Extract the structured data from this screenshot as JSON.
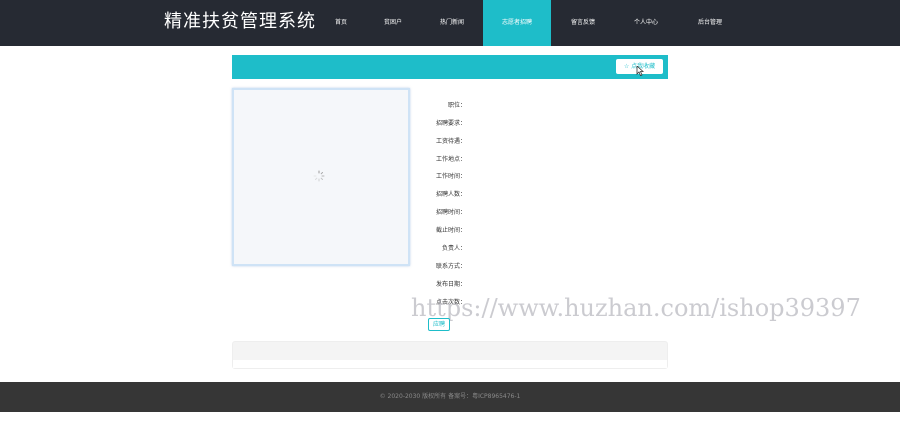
{
  "header": {
    "title": "精准扶贫管理系统",
    "nav": [
      {
        "label": "首页"
      },
      {
        "label": "贫困户"
      },
      {
        "label": "热门新闻"
      },
      {
        "label": "志愿者招聘"
      },
      {
        "label": "留言反馈"
      },
      {
        "label": "个人中心"
      },
      {
        "label": "后台管理"
      }
    ],
    "active_index": 3
  },
  "banner": {
    "favorite_label": "☆ 点我收藏"
  },
  "detail": {
    "fields": [
      {
        "label": "职位：",
        "value": ""
      },
      {
        "label": "招聘要求：",
        "value": ""
      },
      {
        "label": "工资待遇：",
        "value": ""
      },
      {
        "label": "工作地点：",
        "value": ""
      },
      {
        "label": "工作时间：",
        "value": ""
      },
      {
        "label": "招聘人数：",
        "value": ""
      },
      {
        "label": "招聘时间：",
        "value": ""
      },
      {
        "label": "截止时间：",
        "value": ""
      },
      {
        "label": "负责人：",
        "value": ""
      },
      {
        "label": "联系方式：",
        "value": ""
      },
      {
        "label": "发布日期：",
        "value": ""
      },
      {
        "label": "点击次数：",
        "value": ""
      }
    ],
    "apply_label": "应聘"
  },
  "watermark": "https://www.huzhan.com/ishop39397",
  "footer": {
    "text": "© 2020-2030 版权所有 备案号：粤ICP8965476-1"
  },
  "colors": {
    "accent": "#1ebdc9",
    "topbar": "#262a33",
    "footer": "#363636"
  }
}
